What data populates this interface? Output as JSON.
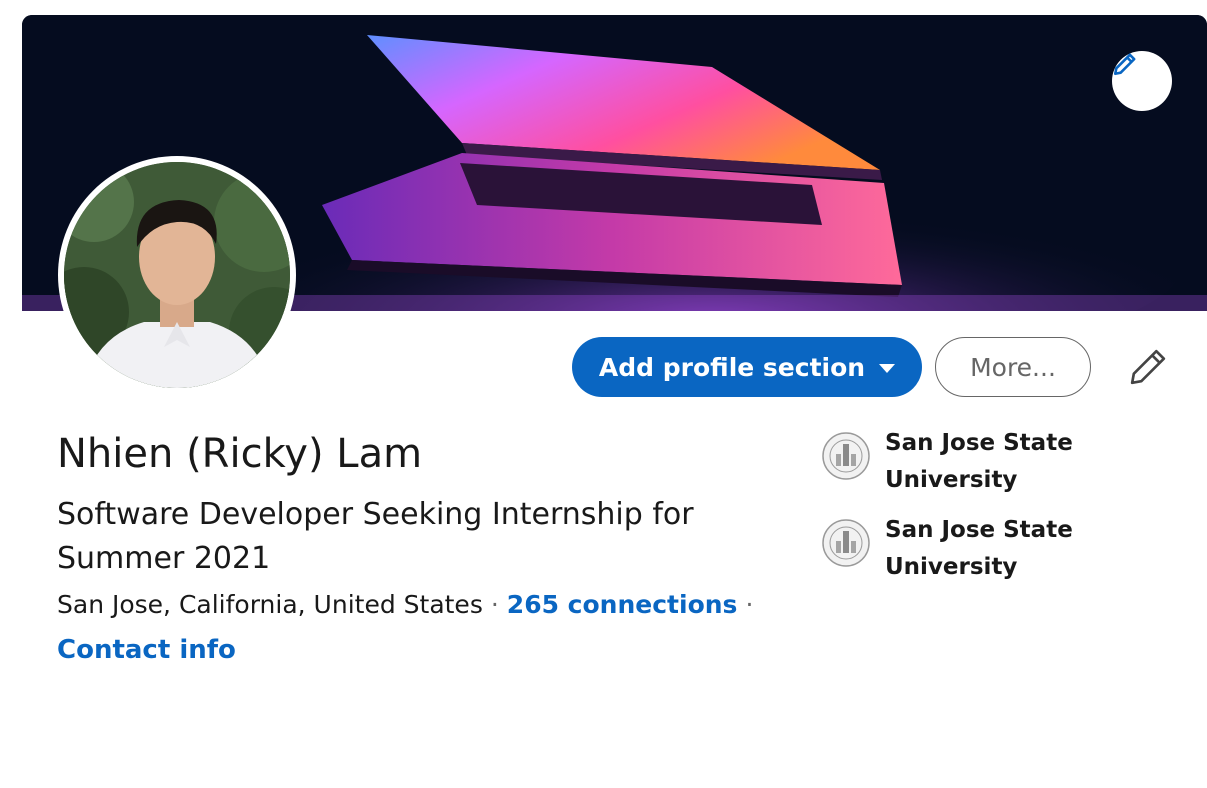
{
  "profile": {
    "name": "Nhien (Ricky) Lam",
    "headline": "Software Developer Seeking Internship for Summer 2021",
    "location": "San Jose, California, United States",
    "connections": "265 connections",
    "separator": "·",
    "contact_info": "Contact info"
  },
  "actions": {
    "add_section_label": "Add profile section",
    "more_label": "More..."
  },
  "education": [
    {
      "school": "San Jose State University"
    },
    {
      "school": "San Jose State University"
    }
  ],
  "colors": {
    "primary": "#0a66c2",
    "text": "#191919",
    "secondary_text": "#666666"
  },
  "icons": {
    "banner_edit": "pencil-icon",
    "intro_edit": "pencil-icon",
    "dropdown": "caret-down-icon",
    "school_logo": "sjsu-seal-icon"
  }
}
